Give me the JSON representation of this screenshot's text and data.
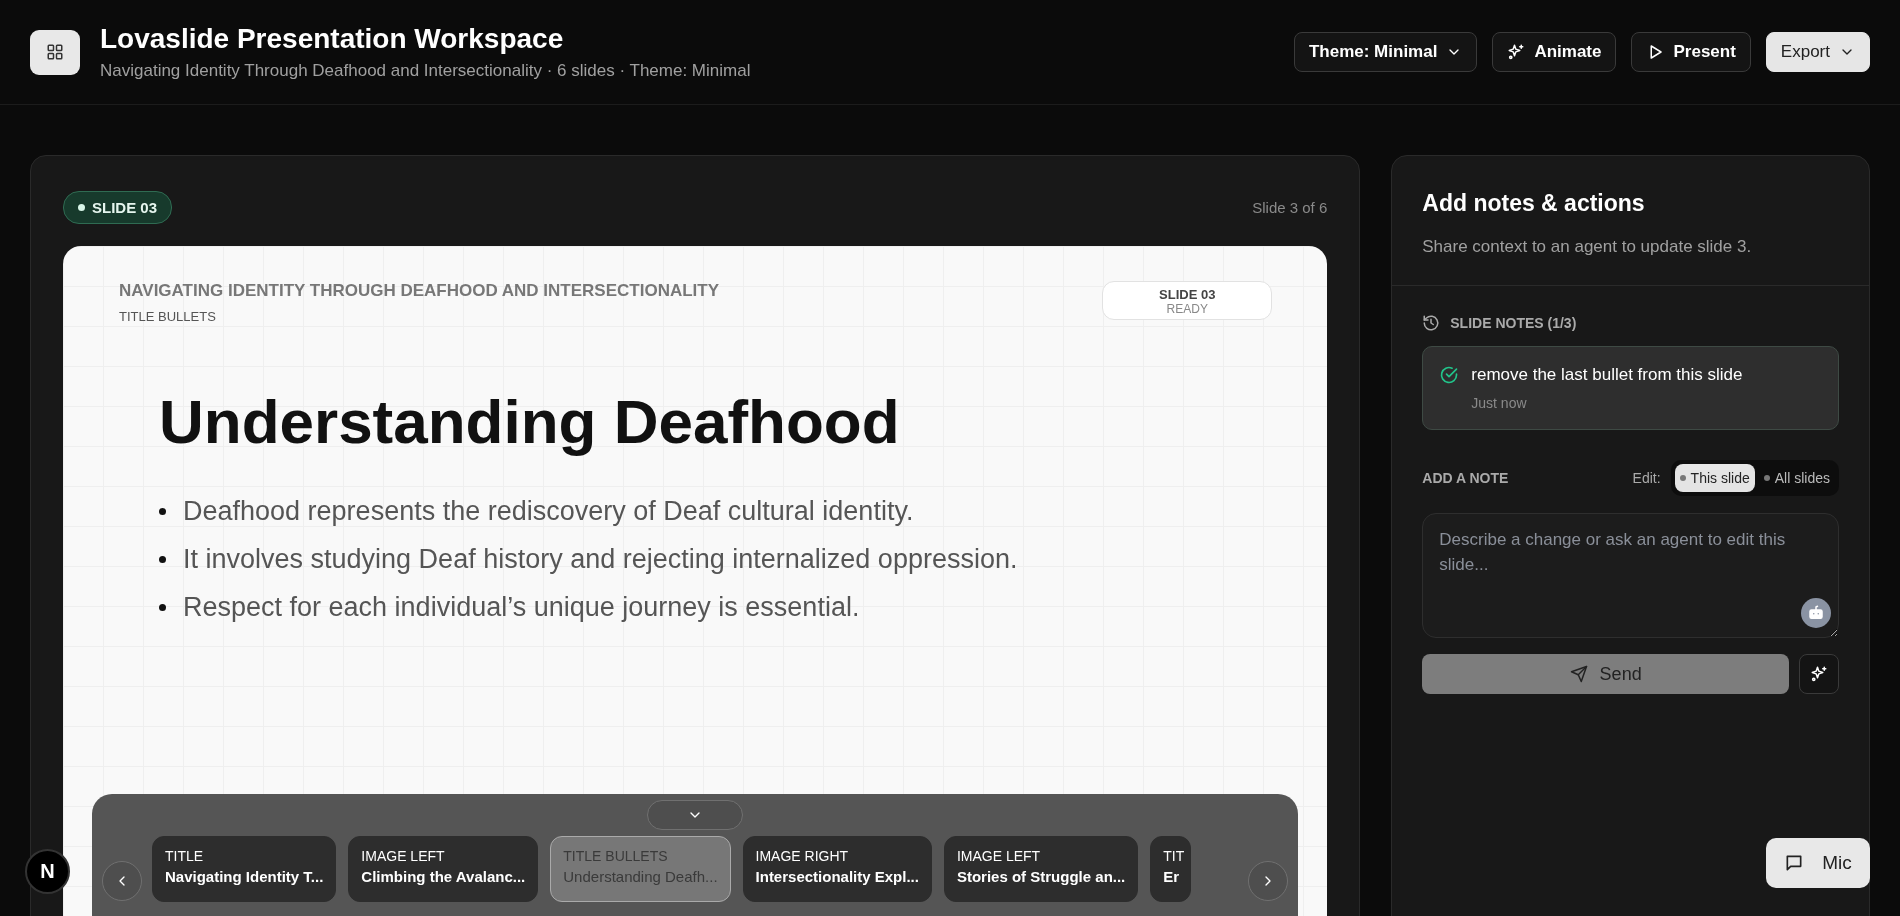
{
  "header": {
    "title": "Lovaslide Presentation Workspace",
    "subtitle": "Navigating Identity Through Deafhood and Intersectionality · 6 slides · Theme: Minimal",
    "actions": [
      {
        "kind": "dropdown",
        "label": "Theme: Minimal"
      },
      {
        "kind": "animate",
        "label": "Animate"
      },
      {
        "kind": "present",
        "label": "Present"
      },
      {
        "kind": "export",
        "label": "Export"
      }
    ]
  },
  "editor": {
    "badge": "SLIDE 03",
    "counter": "Slide 3 of 6",
    "slide": {
      "deck_title": "NAVIGATING IDENTITY THROUGH DEAFHOOD AND INTERSECTIONALITY",
      "layout": "TITLE BULLETS",
      "status_title": "SLIDE 03",
      "status": "READY",
      "title": "Understanding Deafhood",
      "bullets": [
        "Deafhood represents the rediscovery of Deaf cultural identity.",
        "It involves studying Deaf history and rejecting internalized oppression.",
        "Respect for each individual’s unique journey is essential."
      ]
    },
    "thumbnails": [
      {
        "layout": "TITLE",
        "title": "Navigating Identity T...",
        "selected": false
      },
      {
        "layout": "IMAGE LEFT",
        "title": "Climbing the Avalanc...",
        "selected": false
      },
      {
        "layout": "TITLE BULLETS",
        "title": "Understanding Deafh...",
        "selected": true
      },
      {
        "layout": "IMAGE RIGHT",
        "title": "Intersectionality Expl...",
        "selected": false
      },
      {
        "layout": "IMAGE LEFT",
        "title": "Stories of Struggle an...",
        "selected": false
      },
      {
        "layout": "TIT",
        "title": "Er",
        "selected": false
      }
    ]
  },
  "avatar": "N",
  "panel": {
    "title": "Add notes & actions",
    "subtitle": "Share context to an agent to update slide 3.",
    "notes_label": "SLIDE NOTES (1/3)",
    "notes": [
      {
        "text": "remove the last bullet from this slide",
        "time": "Just now"
      }
    ],
    "add_label": "ADD A NOTE",
    "edit_label": "Edit:",
    "scopes": [
      {
        "label": "This slide",
        "selected": true
      },
      {
        "label": "All slides",
        "selected": false
      }
    ],
    "placeholder": "Describe a change or ask an agent to edit this slide...",
    "send": "Send"
  },
  "mic": "Mic"
}
